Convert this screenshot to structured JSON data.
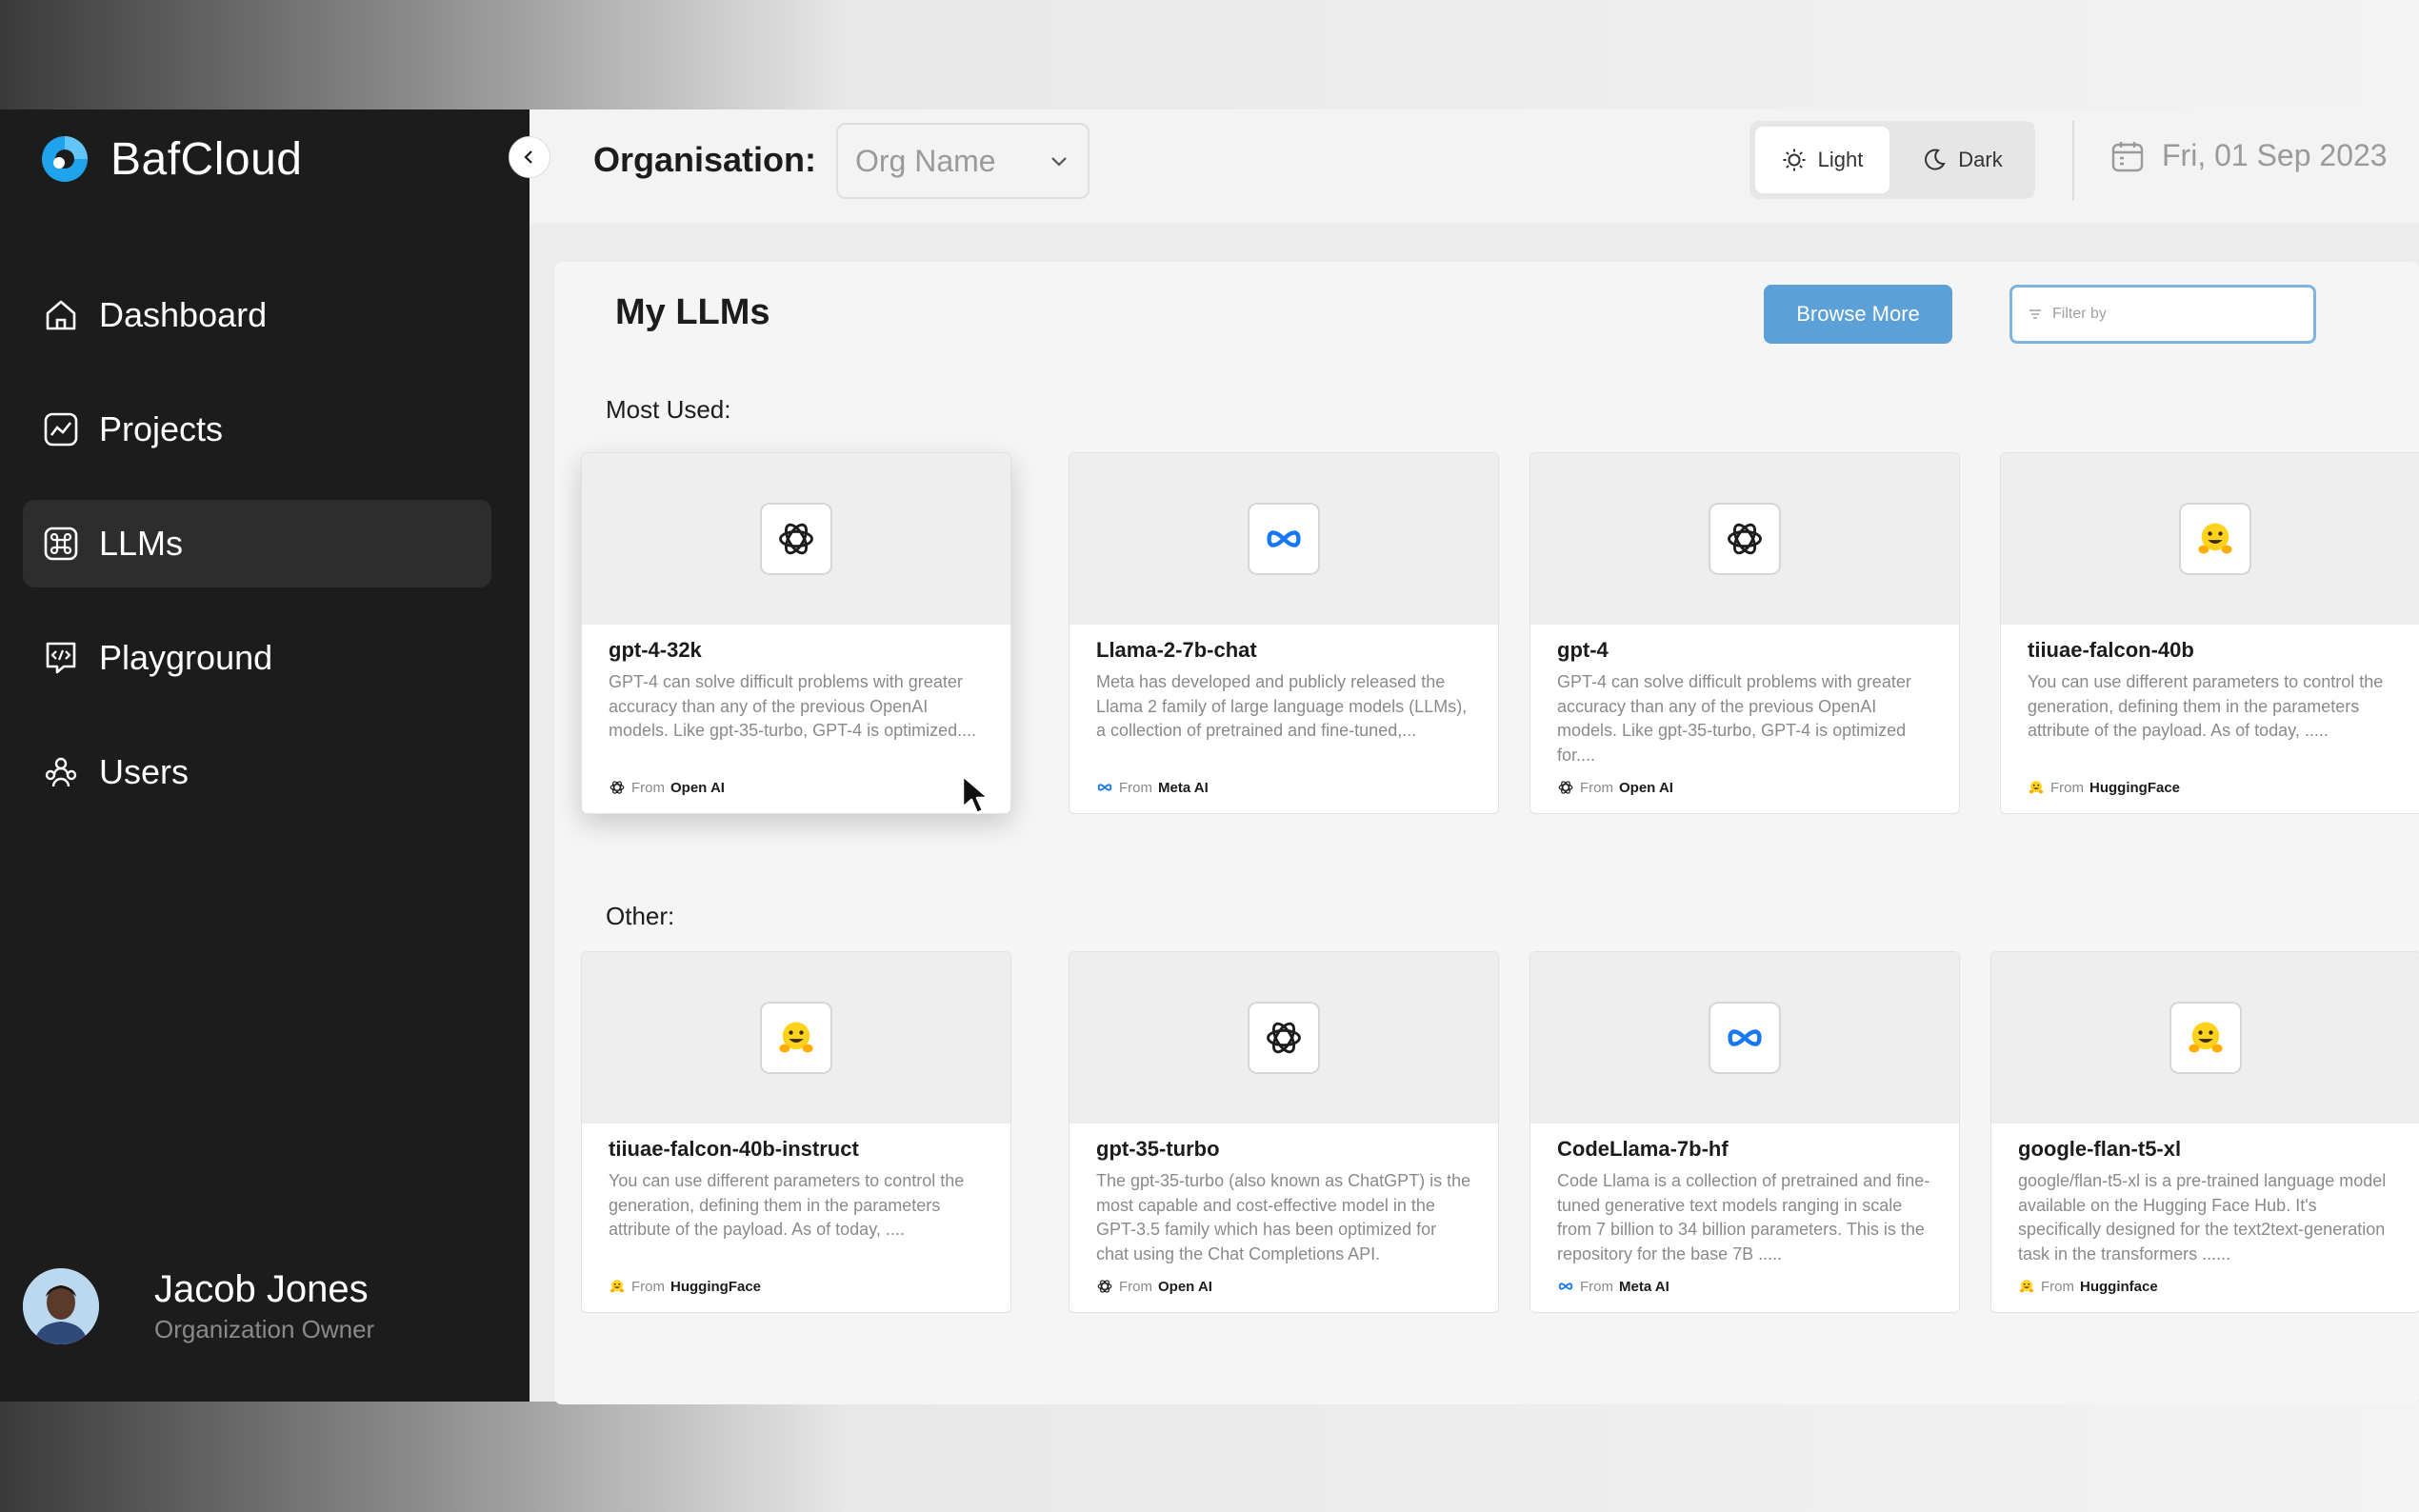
{
  "brand": {
    "name": "BafCloud"
  },
  "sidebar": {
    "items": [
      {
        "label": "Dashboard",
        "icon": "home-icon",
        "active": false
      },
      {
        "label": "Projects",
        "icon": "chart-icon",
        "active": false
      },
      {
        "label": "LLMs",
        "icon": "command-icon",
        "active": true
      },
      {
        "label": "Playground",
        "icon": "code-chat-icon",
        "active": false
      },
      {
        "label": "Users",
        "icon": "users-icon",
        "active": false
      }
    ]
  },
  "user": {
    "name": "Jacob Jones",
    "role": "Organization Owner"
  },
  "topbar": {
    "org_label": "Organisation:",
    "org_select": "Org Name",
    "theme_light": "Light",
    "theme_dark": "Dark",
    "date": "Fri, 01 Sep 2023"
  },
  "main": {
    "title": "My LLMs",
    "browse_label": "Browse More",
    "filter_placeholder": "Filter by",
    "most_used_label": "Most Used:",
    "other_label": "Other:"
  },
  "from_label": "From",
  "colors": {
    "accent": "#5ba0d6",
    "sidebar": "#1c1c1c",
    "meta": "#1877f2"
  },
  "most_used": [
    {
      "name": "gpt-4-32k",
      "provider": "Open AI",
      "icon": "openai-icon",
      "desc": "GPT-4 can solve difficult problems with greater accuracy than any of the previous OpenAI models. Like gpt-35-turbo, GPT-4 is optimized...."
    },
    {
      "name": "Llama-2-7b-chat",
      "provider": "Meta AI",
      "icon": "meta-icon",
      "desc": "Meta has developed and publicly released the Llama 2 family of large language models (LLMs), a collection of pretrained and fine-tuned,..."
    },
    {
      "name": "gpt-4",
      "provider": "Open AI",
      "icon": "openai-icon",
      "desc": "GPT-4 can solve difficult problems with greater accuracy than any of the previous OpenAI models. Like gpt-35-turbo, GPT-4 is optimized for...."
    },
    {
      "name": "tiiuae-falcon-40b",
      "provider": "HuggingFace",
      "icon": "huggingface-icon",
      "desc": "You can use different parameters to control the generation, defining them in the parameters attribute of the payload. As of today, ....."
    }
  ],
  "other": [
    {
      "name": "tiiuae-falcon-40b-instruct",
      "provider": "HuggingFace",
      "icon": "huggingface-icon",
      "desc": "You can use different parameters to control the generation, defining them in the parameters attribute of the payload. As of today, ...."
    },
    {
      "name": "gpt-35-turbo",
      "provider": "Open AI",
      "icon": "openai-icon",
      "desc": "The gpt-35-turbo (also known as ChatGPT) is the most capable and cost-effective model in the GPT-3.5 family which has been optimized for chat using the Chat Completions API."
    },
    {
      "name": "CodeLlama-7b-hf",
      "provider": "Meta AI",
      "icon": "meta-icon",
      "desc": "Code Llama is a collection of pretrained and fine-tuned generative text models ranging in scale from 7 billion to 34 billion parameters. This is the repository for the base 7B ....."
    },
    {
      "name": "google-flan-t5-xl",
      "provider": "Hugginface",
      "icon": "huggingface-icon",
      "desc": "google/flan-t5-xl is a pre-trained language model available on the Hugging Face Hub. It's specifically designed for the text2text-generation task in the transformers ......"
    }
  ]
}
